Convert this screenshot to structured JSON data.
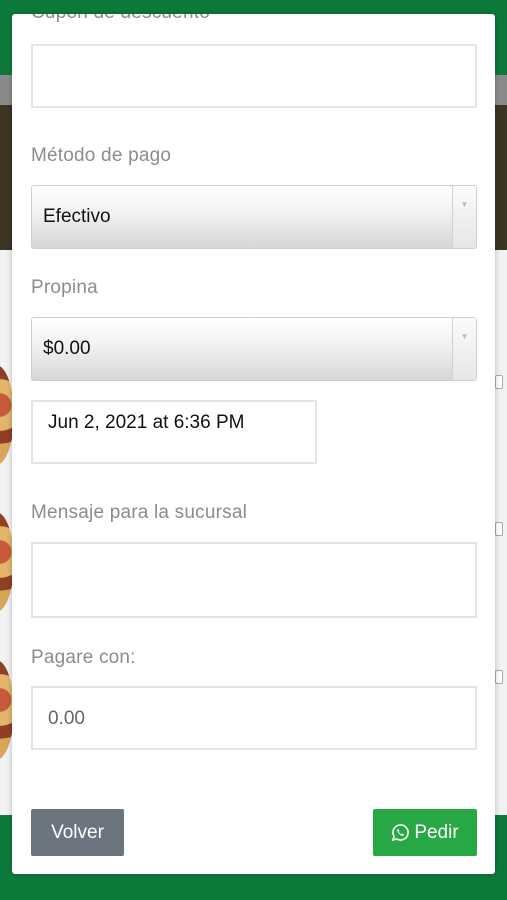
{
  "form": {
    "coupon_label": "Cupón de descuento",
    "coupon_value": "",
    "payment_label": "Método de pago",
    "payment_selected": "Efectivo",
    "tip_label": "Propina",
    "tip_selected": "$0.00",
    "datetime_value": "Jun 2, 2021 at 6:36 PM",
    "message_label": "Mensaje para la sucursal",
    "message_value": "",
    "pay_with_label": "Pagare con:",
    "pay_with_value": "0.00"
  },
  "buttons": {
    "back_label": "Volver",
    "order_label": "Pedir",
    "order_icon": "whatsapp-icon"
  },
  "colors": {
    "brand_green": "#0d7a3b",
    "order_button": "#28a745",
    "back_button": "#6c757d"
  }
}
